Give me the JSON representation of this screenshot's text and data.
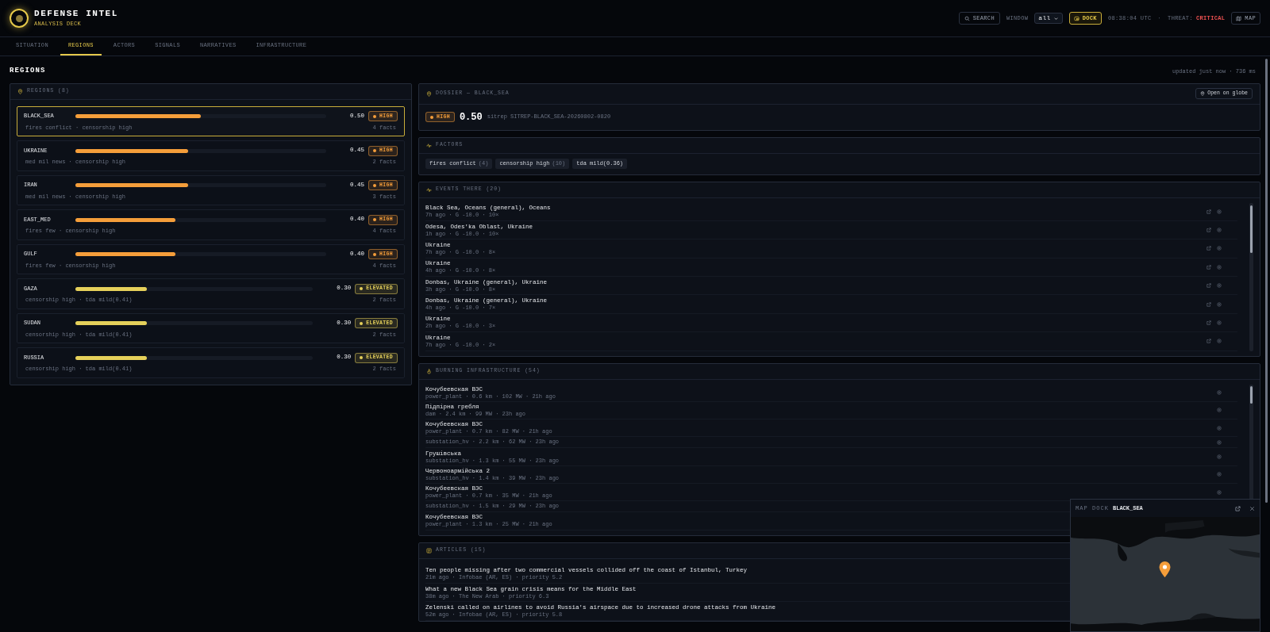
{
  "app": {
    "title": "DEFENSE INTEL",
    "subtitle": "ANALYSIS DECK"
  },
  "toolbar": {
    "search": "SEARCH",
    "window_label": "WINDOW",
    "window_value": "all",
    "dock": "DOCK",
    "dock_on": true,
    "time": "08:38:04 UTC",
    "separator": "·",
    "threat_label": "THREAT:",
    "threat_value": "CRITICAL",
    "map": "MAP"
  },
  "tabs": [
    {
      "label": "SITUATION",
      "selected": false
    },
    {
      "label": "REGIONS",
      "selected": true
    },
    {
      "label": "ACTORS",
      "selected": false
    },
    {
      "label": "SIGNALS",
      "selected": false
    },
    {
      "label": "NARRATIVES",
      "selected": false
    },
    {
      "label": "INFRASTRUCTURE",
      "selected": false
    }
  ],
  "page": {
    "heading": "REGIONS",
    "updated": "updated just now · 736 ms"
  },
  "regions_panel": {
    "title": "REGIONS (8)",
    "items": [
      {
        "name": "BLACK_SEA",
        "level": 0.5,
        "score": "0.50",
        "color": "#f59e3a",
        "badge": "HIGH",
        "factors": "fires conflict · censorship high",
        "facts": "4 facts",
        "selected": true
      },
      {
        "name": "UKRAINE",
        "level": 0.45,
        "score": "0.45",
        "color": "#f59e3a",
        "badge": "HIGH",
        "factors": "med mil news · censorship high",
        "facts": "2 facts",
        "selected": false
      },
      {
        "name": "IRAN",
        "level": 0.45,
        "score": "0.45",
        "color": "#f59e3a",
        "badge": "HIGH",
        "factors": "med mil news · censorship high",
        "facts": "3 facts",
        "selected": false
      },
      {
        "name": "EAST_MED",
        "level": 0.4,
        "score": "0.40",
        "color": "#f59e3a",
        "badge": "HIGH",
        "factors": "fires few · censorship high",
        "facts": "4 facts",
        "selected": false
      },
      {
        "name": "GULF",
        "level": 0.4,
        "score": "0.40",
        "color": "#f59e3a",
        "badge": "HIGH",
        "factors": "fires few · censorship high",
        "facts": "4 facts",
        "selected": false
      },
      {
        "name": "GAZA",
        "level": 0.3,
        "score": "0.30",
        "color": "#e5d05a",
        "badge": "ELEVATED",
        "factors": "censorship high · tda mild(0.41)",
        "facts": "2 facts",
        "selected": false
      },
      {
        "name": "SUDAN",
        "level": 0.3,
        "score": "0.30",
        "color": "#e5d05a",
        "badge": "ELEVATED",
        "factors": "censorship high · tda mild(0.41)",
        "facts": "2 facts",
        "selected": false
      },
      {
        "name": "RUSSIA",
        "level": 0.3,
        "score": "0.30",
        "color": "#e5d05a",
        "badge": "ELEVATED",
        "factors": "censorship high · tda mild(0.41)",
        "facts": "2 facts",
        "selected": false
      }
    ]
  },
  "dossier": {
    "title": "DOSSIER — BLACK_SEA",
    "button": "Open on globe",
    "color": "#f59e3a",
    "badge": "HIGH",
    "score": "0.50",
    "sitrep": "sitrep SITREP-BLACK_SEA-20260802-0820"
  },
  "factors": {
    "title": "FACTORS",
    "chips": [
      {
        "label": "fires conflict",
        "count": "(4)"
      },
      {
        "label": "censorship high",
        "count": "(10)"
      },
      {
        "label": "tda mild(0.36)"
      }
    ]
  },
  "events": {
    "title": "EVENTS THERE (20)",
    "items": [
      {
        "title": "Black Sea, Oceans (general), Oceans",
        "meta": "7h ago · G -10.0 · 10×"
      },
      {
        "title": "Odesa, Odes'ka Oblast, Ukraine",
        "meta": "1h ago · G -10.0 · 10×"
      },
      {
        "title": "Ukraine",
        "meta": "7h ago · G -10.0 · 8×"
      },
      {
        "title": "Ukraine",
        "meta": "4h ago · G -10.0 · 8×"
      },
      {
        "title": "Donbas, Ukraine (general), Ukraine",
        "meta": "3h ago · G -10.0 · 8×"
      },
      {
        "title": "Donbas, Ukraine (general), Ukraine",
        "meta": "4h ago · G -10.0 · 7×"
      },
      {
        "title": "Ukraine",
        "meta": "2h ago · G -10.0 · 3×"
      },
      {
        "title": "Ukraine",
        "meta": "7h ago · G -10.0 · 2×"
      }
    ]
  },
  "infrastructure": {
    "title": "BURNING INFRASTRUCTURE (54)",
    "items": [
      {
        "name": "Кочубеевская ВЭС",
        "meta": "power_plant · 0.6 km · 102 MW · 21h ago"
      },
      {
        "name": "Підпірна гребля",
        "meta": "dam · 2.4 km · 99 MW · 23h ago"
      },
      {
        "name": "Кочубеевская ВЭС",
        "meta": "power_plant · 0.7 km · 82 MW · 21h ago"
      },
      {
        "meta": "substation_hv · 2.2 km · 62 MW · 23h ago"
      },
      {
        "name": "Грушівська",
        "meta": "substation_hv · 1.3 km · 55 MW · 23h ago"
      },
      {
        "name": "Червоноармійська 2",
        "meta": "substation_hv · 1.4 km · 39 MW · 23h ago"
      },
      {
        "name": "Кочубеевская ВЭС",
        "meta": "power_plant · 0.7 km · 35 MW · 21h ago"
      },
      {
        "meta": "substation_hv · 1.5 km · 29 MW · 23h ago"
      },
      {
        "name": "Кочубеевская ВЭС",
        "meta": "power_plant · 1.3 km · 25 MW · 21h ago"
      }
    ]
  },
  "articles": {
    "title": "ARTICLES (15)",
    "items": [
      {
        "title": "Ten people missing after two commercial vessels collided off the coast of Istanbul, Turkey",
        "meta": "21m ago · Infobae (AR, ES) · priority 5.2"
      },
      {
        "title": "What a new Black Sea grain crisis means for the Middle East",
        "meta": "38m ago · The New Arab · priority 6.3"
      },
      {
        "title": "Zelenski called on airlines to avoid Russia's airspace due to increased drone attacks from Ukraine",
        "meta": "52m ago · Infobae (AR, ES) · priority 5.8"
      }
    ]
  },
  "map_dock": {
    "label": "MAP DOCK",
    "region": "BLACK_SEA"
  }
}
